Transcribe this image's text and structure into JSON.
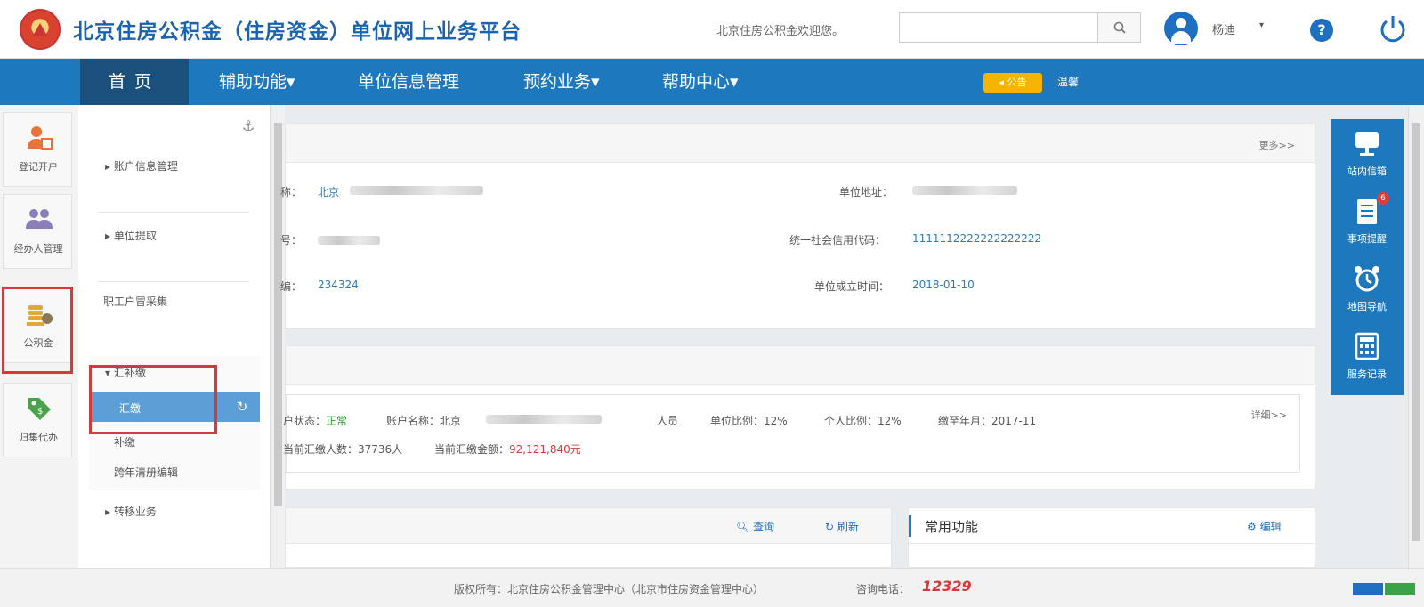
{
  "header": {
    "title": "北京住房公积金（住房资金）单位网上业务平台",
    "welcome": "北京住房公积金欢迎您。",
    "search_placeholder": "",
    "user_name": "杨迪",
    "user_caret": "▾",
    "help_label": "?"
  },
  "nav": {
    "items": [
      "首页",
      "辅助功能▾",
      "单位信息管理",
      "预约业务▾",
      "帮助中心▾"
    ],
    "notice_badge": "◂ 公告",
    "notice_text": "温馨"
  },
  "leftbar": {
    "items": [
      {
        "label": "登记开户",
        "icon": "register-icon"
      },
      {
        "label": "经办人管理",
        "icon": "users-icon"
      },
      {
        "label": "公积金",
        "icon": "coins-icon"
      },
      {
        "label": "归集代办",
        "icon": "tag-icon"
      }
    ]
  },
  "submenu": {
    "items": [
      "账户信息管理",
      "单位提取",
      "职工户冒采集"
    ],
    "group_label": "▾ 汇补缴",
    "group_children": [
      "汇缴",
      "补缴",
      "跨年清册编辑"
    ],
    "last_item": "转移业务"
  },
  "info_card": {
    "more": "更多>>",
    "left_labels": [
      "称：",
      "号：",
      "编："
    ],
    "left_values": [
      "北京",
      "",
      "234324"
    ],
    "right_labels": [
      "单位地址：",
      "统一社会信用代码：",
      "单位成立时间："
    ],
    "right_values": [
      "",
      "1111112222222222222",
      "2018-01-10"
    ]
  },
  "account_card": {
    "detail": "详细>>",
    "status_label": "户状态：",
    "status_value": "正常",
    "name_label": "账户名称：北京",
    "personnel": "人员",
    "unit_ratio": "单位比例：12%",
    "personal_ratio": "个人比例：12%",
    "paid_until": "缴至年月：2017-11",
    "count_label": "当前汇缴人数：37736人",
    "amount_label": "当前汇缴金额：",
    "amount_value": "92,121,840元"
  },
  "bottom_cards": {
    "query": "查询",
    "refresh": "刷新",
    "common_title": "常用功能",
    "edit": "编辑"
  },
  "right_panel": {
    "items": [
      "站内信箱",
      "事项提醒",
      "地图导航",
      "服务记录"
    ],
    "badge": "6"
  },
  "footer": {
    "copyright": "版权所有：北京住房公积金管理中心（北京市住房资金管理中心）",
    "hotline_label": "咨询电话：",
    "hotline": "12329"
  }
}
